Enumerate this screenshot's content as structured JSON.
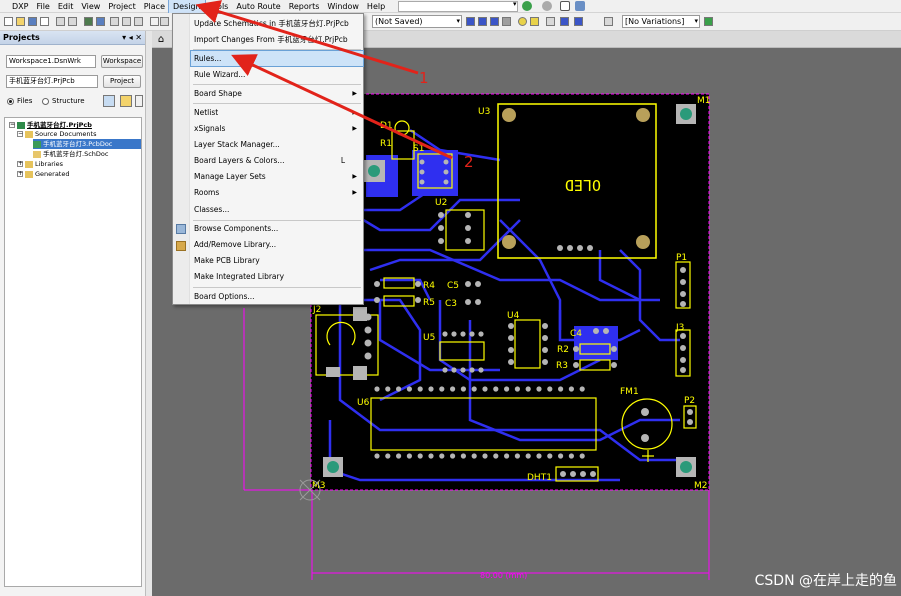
{
  "menubar": {
    "items": [
      "DXP",
      "File",
      "Edit",
      "View",
      "Project",
      "Place",
      "Design",
      "Tools",
      "Auto Route",
      "Reports",
      "Window",
      "Help"
    ],
    "active": "Design"
  },
  "toolbar": {
    "saved_status": "(Not Saved)",
    "variations": "[No Variations]"
  },
  "projects_panel": {
    "title": "Projects",
    "header_icons": "▾ ◂ ✕",
    "workspace_combo": "Workspace1.DsnWrk",
    "workspace_button": "Workspace",
    "project_combo": "手机蓝牙台灯.PrjPcb",
    "project_button": "Project",
    "view_files": "Files",
    "view_structure": "Structure",
    "tree": {
      "project": "手机蓝牙台灯.PrjPcb",
      "source_documents": "Source Documents",
      "pcb_doc": "手机蓝牙台灯3.PcbDoc",
      "sch_doc": "手机蓝牙台灯.SchDoc",
      "libraries": "Libraries",
      "generated": "Generated"
    }
  },
  "design_menu": {
    "items": [
      {
        "label": "Update Schematics in 手机蓝牙台灯.PrjPcb"
      },
      {
        "label": "Import Changes From 手机蓝牙台灯.PrjPcb"
      },
      {
        "label": "Rules..."
      },
      {
        "label": "Rule Wizard..."
      },
      {
        "label": "Board Shape"
      },
      {
        "label": "Netlist"
      },
      {
        "label": "xSignals"
      },
      {
        "label": "Layer Stack Manager..."
      },
      {
        "label": "Board Layers & Colors...",
        "shortcut": "L"
      },
      {
        "label": "Manage Layer Sets"
      },
      {
        "label": "Rooms"
      },
      {
        "label": "Classes..."
      },
      {
        "label": "Browse Components..."
      },
      {
        "label": "Add/Remove Library..."
      },
      {
        "label": "Make PCB Library"
      },
      {
        "label": "Make Integrated Library"
      },
      {
        "label": "Board Options..."
      }
    ]
  },
  "pcb": {
    "labels": {
      "M1": "M1",
      "M2": "M2",
      "M3": "M3",
      "U2": "U2",
      "U3": "U3",
      "U4": "U4",
      "U5": "U5",
      "U6": "U6",
      "R1": "R1",
      "R2": "R2",
      "R3": "R3",
      "R4": "R4",
      "R5": "R5",
      "C3": "C3",
      "C4": "C4",
      "C5": "C5",
      "D1": "D1",
      "S1": "S1",
      "J2": "J2",
      "J3": "J3",
      "P1": "P1",
      "P2": "P2",
      "FM1": "FM1",
      "DHT1": "DHT1",
      "oled": "OLED",
      "dimension": "80.00 (mm)"
    },
    "colors": {
      "board": "#000000",
      "copper": "#2f2ff0",
      "silk": "#ffff00",
      "pad": "#c0c0c0",
      "outline": "#ff00ff"
    }
  },
  "annotations": {
    "num1": "1",
    "num2": "2",
    "color": "#e2231a"
  },
  "watermark": "CSDN @在岸上走的鱼"
}
